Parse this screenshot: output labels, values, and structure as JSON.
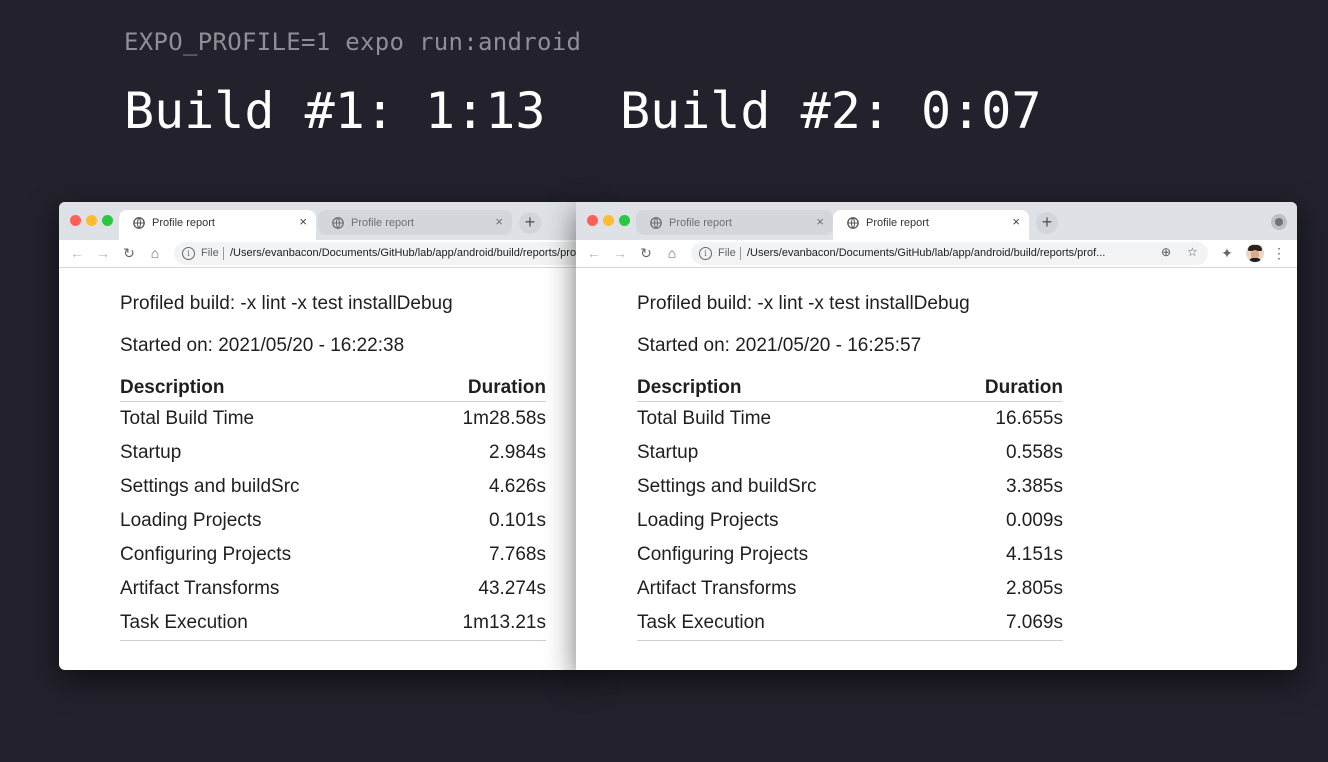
{
  "command": "EXPO_PROFILE=1 expo run:android",
  "builds": {
    "build1": "Build #1: 1:13",
    "build2": "Build #2: 0:07"
  },
  "window1": {
    "tabs": [
      {
        "title": "Profile report",
        "active": true
      },
      {
        "title": "Profile report",
        "active": false
      }
    ],
    "address": {
      "scheme": "File",
      "url": "/Users/evanbacon/Documents/GitHub/lab/app/android/build/reports/profile"
    },
    "report": {
      "profiled": "Profiled build: -x lint -x test installDebug",
      "started": "Started on: 2021/05/20 - 16:22:38",
      "headers": {
        "description": "Description",
        "duration": "Duration"
      },
      "rows": [
        {
          "description": "Total Build Time",
          "duration": "1m28.58s"
        },
        {
          "description": "Startup",
          "duration": "2.984s"
        },
        {
          "description": "Settings and buildSrc",
          "duration": "4.626s"
        },
        {
          "description": "Loading Projects",
          "duration": "0.101s"
        },
        {
          "description": "Configuring Projects",
          "duration": "7.768s"
        },
        {
          "description": "Artifact Transforms",
          "duration": "43.274s"
        },
        {
          "description": "Task Execution",
          "duration": "1m13.21s"
        }
      ]
    }
  },
  "window2": {
    "tabs": [
      {
        "title": "Profile report",
        "active": false
      },
      {
        "title": "Profile report",
        "active": true
      }
    ],
    "address": {
      "scheme": "File",
      "url": "/Users/evanbacon/Documents/GitHub/lab/app/android/build/reports/prof..."
    },
    "report": {
      "profiled": "Profiled build: -x lint -x test installDebug",
      "started": "Started on: 2021/05/20 - 16:25:57",
      "headers": {
        "description": "Description",
        "duration": "Duration"
      },
      "rows": [
        {
          "description": "Total Build Time",
          "duration": "16.655s"
        },
        {
          "description": "Startup",
          "duration": "0.558s"
        },
        {
          "description": "Settings and buildSrc",
          "duration": "3.385s"
        },
        {
          "description": "Loading Projects",
          "duration": "0.009s"
        },
        {
          "description": "Configuring Projects",
          "duration": "4.151s"
        },
        {
          "description": "Artifact Transforms",
          "duration": "2.805s"
        },
        {
          "description": "Task Execution",
          "duration": "7.069s"
        }
      ]
    }
  },
  "icons": {
    "close": "×",
    "new_tab": "+",
    "back": "←",
    "forward": "→",
    "reload": "↻",
    "home": "⌂",
    "info": "i",
    "zoom": "⊕",
    "star": "☆",
    "extensions": "✦",
    "menu": "⋮"
  },
  "colors": {
    "background": "#22212c",
    "tab_strip": "#dee1e6",
    "traffic_red": "#fe5f57",
    "traffic_yellow": "#febc2e",
    "traffic_green": "#28c840"
  }
}
